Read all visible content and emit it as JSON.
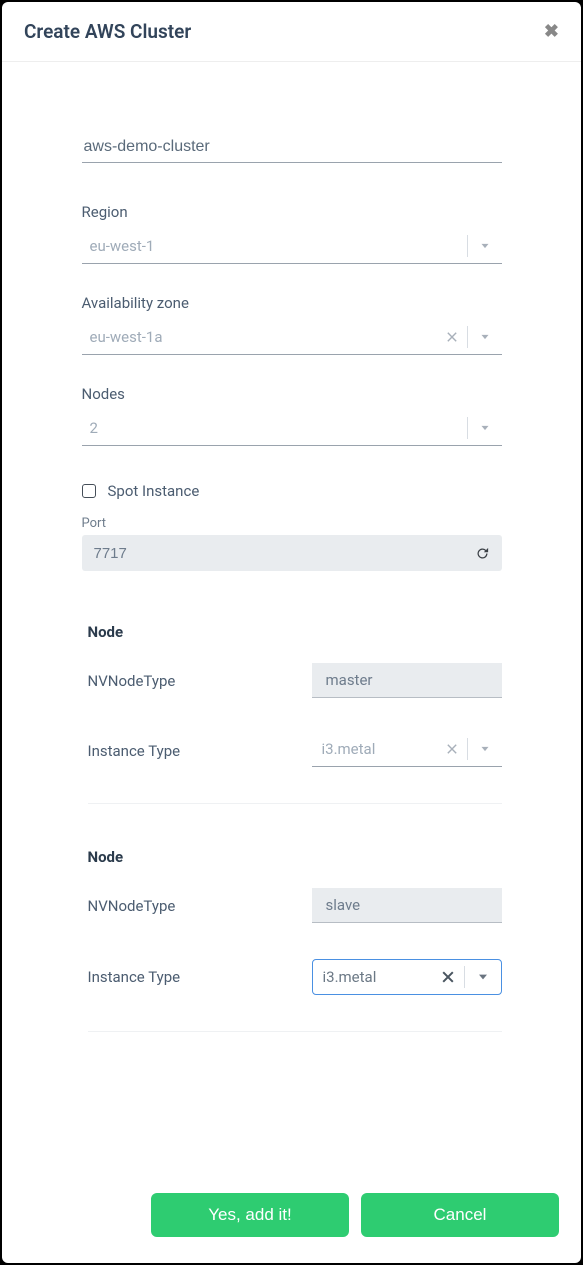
{
  "modal": {
    "title": "Create AWS Cluster",
    "cluster_name": "aws-demo-cluster",
    "region": {
      "label": "Region",
      "value": "eu-west-1"
    },
    "az": {
      "label": "Availability zone",
      "value": "eu-west-1a"
    },
    "nodes": {
      "label": "Nodes",
      "value": "2"
    },
    "spot": {
      "label": "Spot Instance",
      "checked": false
    },
    "port": {
      "label": "Port",
      "value": "7717"
    },
    "node1": {
      "heading": "Node",
      "type_label": "NVNodeType",
      "type_value": "master",
      "inst_label": "Instance Type",
      "inst_value": "i3.metal"
    },
    "node2": {
      "heading": "Node",
      "type_label": "NVNodeType",
      "type_value": "slave",
      "inst_label": "Instance Type",
      "inst_value": "i3.metal"
    },
    "footer": {
      "confirm": "Yes, add it!",
      "cancel": "Cancel"
    }
  }
}
